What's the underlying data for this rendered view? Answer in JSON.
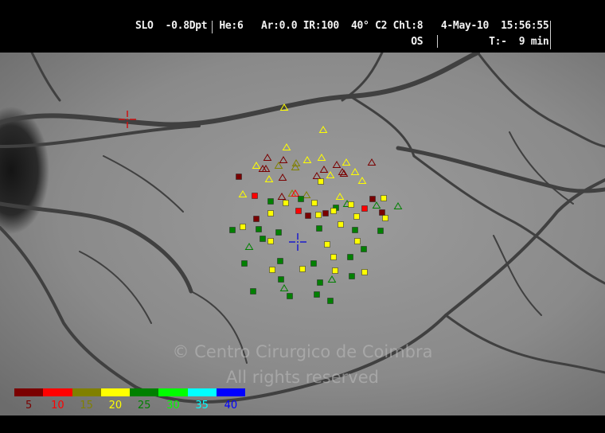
{
  "header": {
    "line1": "SLO  -0.8Dpt  He:6   Ar:0.0 IR:100  40° C2 Chl:8   4-May-10  15:56:55",
    "line2": "                                              OS           T:-  9 min"
  },
  "watermark": {
    "line1": "© Centro Cirurgico de Coimbra",
    "line2": "All rights reserved"
  },
  "legend": {
    "items": [
      {
        "label": "5",
        "color": "#7a0000"
      },
      {
        "label": "10",
        "color": "#ff0000"
      },
      {
        "label": "15",
        "color": "#808000"
      },
      {
        "label": "20",
        "color": "#ffff00"
      },
      {
        "label": "25",
        "color": "#008000"
      },
      {
        "label": "30",
        "color": "#00ff00"
      },
      {
        "label": "35",
        "color": "#00ffff"
      },
      {
        "label": "40",
        "color": "#0000ff"
      }
    ]
  },
  "markers": {
    "fixation_color": "#cc1111",
    "stimulus_color": "#1a1acc"
  }
}
